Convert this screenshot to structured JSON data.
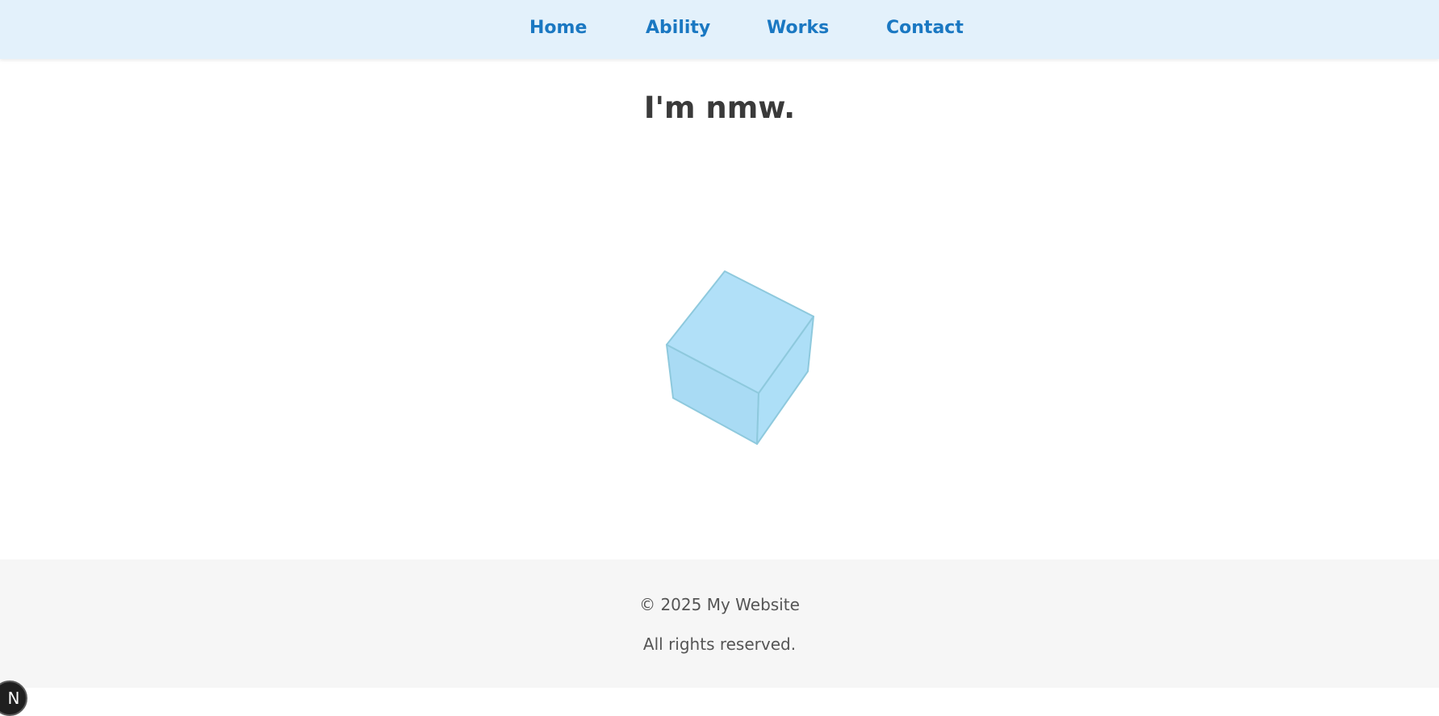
{
  "nav": {
    "items": [
      {
        "label": "Home"
      },
      {
        "label": "Ability"
      },
      {
        "label": "Works"
      },
      {
        "label": "Contact"
      }
    ]
  },
  "hero": {
    "title": "I'm nmw."
  },
  "footer": {
    "copyright": "© 2025 My Website",
    "rights": "All rights reserved."
  },
  "dev_badge": {
    "letter": "N"
  },
  "colors": {
    "nav_background": "#e3f1fb",
    "nav_link": "#1a78c2",
    "cube_face": "#addff7",
    "cube_edge": "#8ec9dd",
    "footer_background": "#f6f6f6"
  },
  "icons": {
    "cube": "3d-cube-icon",
    "dev_badge": "nextjs-icon"
  }
}
